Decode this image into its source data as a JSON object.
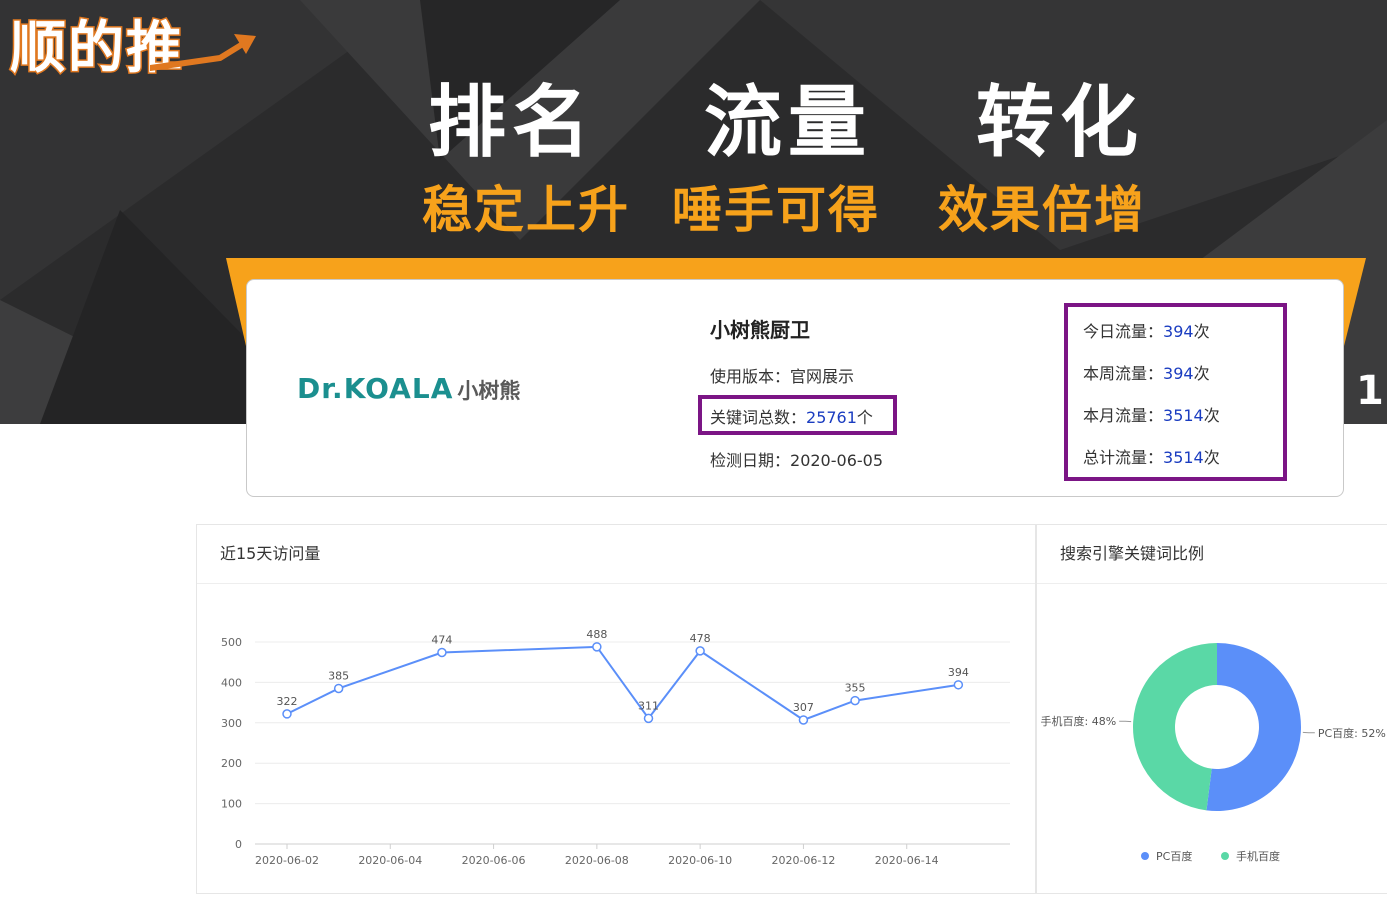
{
  "banner": {
    "logo_text": "顺的推",
    "headlines": [
      "排名",
      "流量",
      "转化"
    ],
    "sublines": [
      "稳定上升",
      "唾手可得",
      "效果倍增"
    ],
    "edge_number": "1",
    "colors": {
      "accent": "#f7a21b",
      "background": "#2b2b2c",
      "logo_orange": "#e07820"
    }
  },
  "site": {
    "logo_text_latin": "Dr.KOALA",
    "logo_text_cn": "小树熊",
    "name": "小树熊厨卫",
    "version_label": "使用版本：",
    "version_value": "官网展示",
    "keyword_label": "关键词总数：",
    "keyword_value": "25761",
    "keyword_unit": "个",
    "check_date_label": "检测日期：",
    "check_date_value": "2020-06-05"
  },
  "traffic": [
    {
      "label": "今日流量：",
      "value": "394",
      "unit": "次"
    },
    {
      "label": "本周流量：",
      "value": "394",
      "unit": "次"
    },
    {
      "label": "本月流量：",
      "value": "3514",
      "unit": "次"
    },
    {
      "label": "总计流量：",
      "value": "3514",
      "unit": "次"
    }
  ],
  "visits_panel": {
    "title": "近15天访问量"
  },
  "ratio_panel": {
    "title": "搜索引擎关键词比例"
  },
  "chart_data": [
    {
      "type": "line",
      "title": "近15天访问量",
      "x_ticks": [
        "2020-06-02",
        "2020-06-04",
        "2020-06-06",
        "2020-06-08",
        "2020-06-10",
        "2020-06-12",
        "2020-06-14"
      ],
      "y_ticks": [
        0,
        100,
        200,
        300,
        400,
        500
      ],
      "ylim": [
        0,
        500
      ],
      "xlim": [
        "2020-06-02",
        "2020-06-16"
      ],
      "series": [
        {
          "color": "#5b8ff9",
          "points": [
            {
              "x": "2020-06-02",
              "y": 322
            },
            {
              "x": "2020-06-03",
              "y": 385
            },
            {
              "x": "2020-06-05",
              "y": 474
            },
            {
              "x": "2020-06-08",
              "y": 488
            },
            {
              "x": "2020-06-09",
              "y": 311
            },
            {
              "x": "2020-06-10",
              "y": 478
            },
            {
              "x": "2020-06-12",
              "y": 307
            },
            {
              "x": "2020-06-13",
              "y": 355
            },
            {
              "x": "2020-06-15",
              "y": 394
            }
          ]
        }
      ],
      "grid": true
    },
    {
      "type": "pie",
      "title": "搜索引擎关键词比例",
      "slices": [
        {
          "label": "PC百度",
          "percent": 52,
          "color": "#5b8ff9",
          "text": "PC百度: 52%"
        },
        {
          "label": "手机百度",
          "percent": 48,
          "color": "#5ad8a6",
          "text": "手机百度: 48%"
        }
      ],
      "legend": "bottom",
      "donut": true
    }
  ]
}
